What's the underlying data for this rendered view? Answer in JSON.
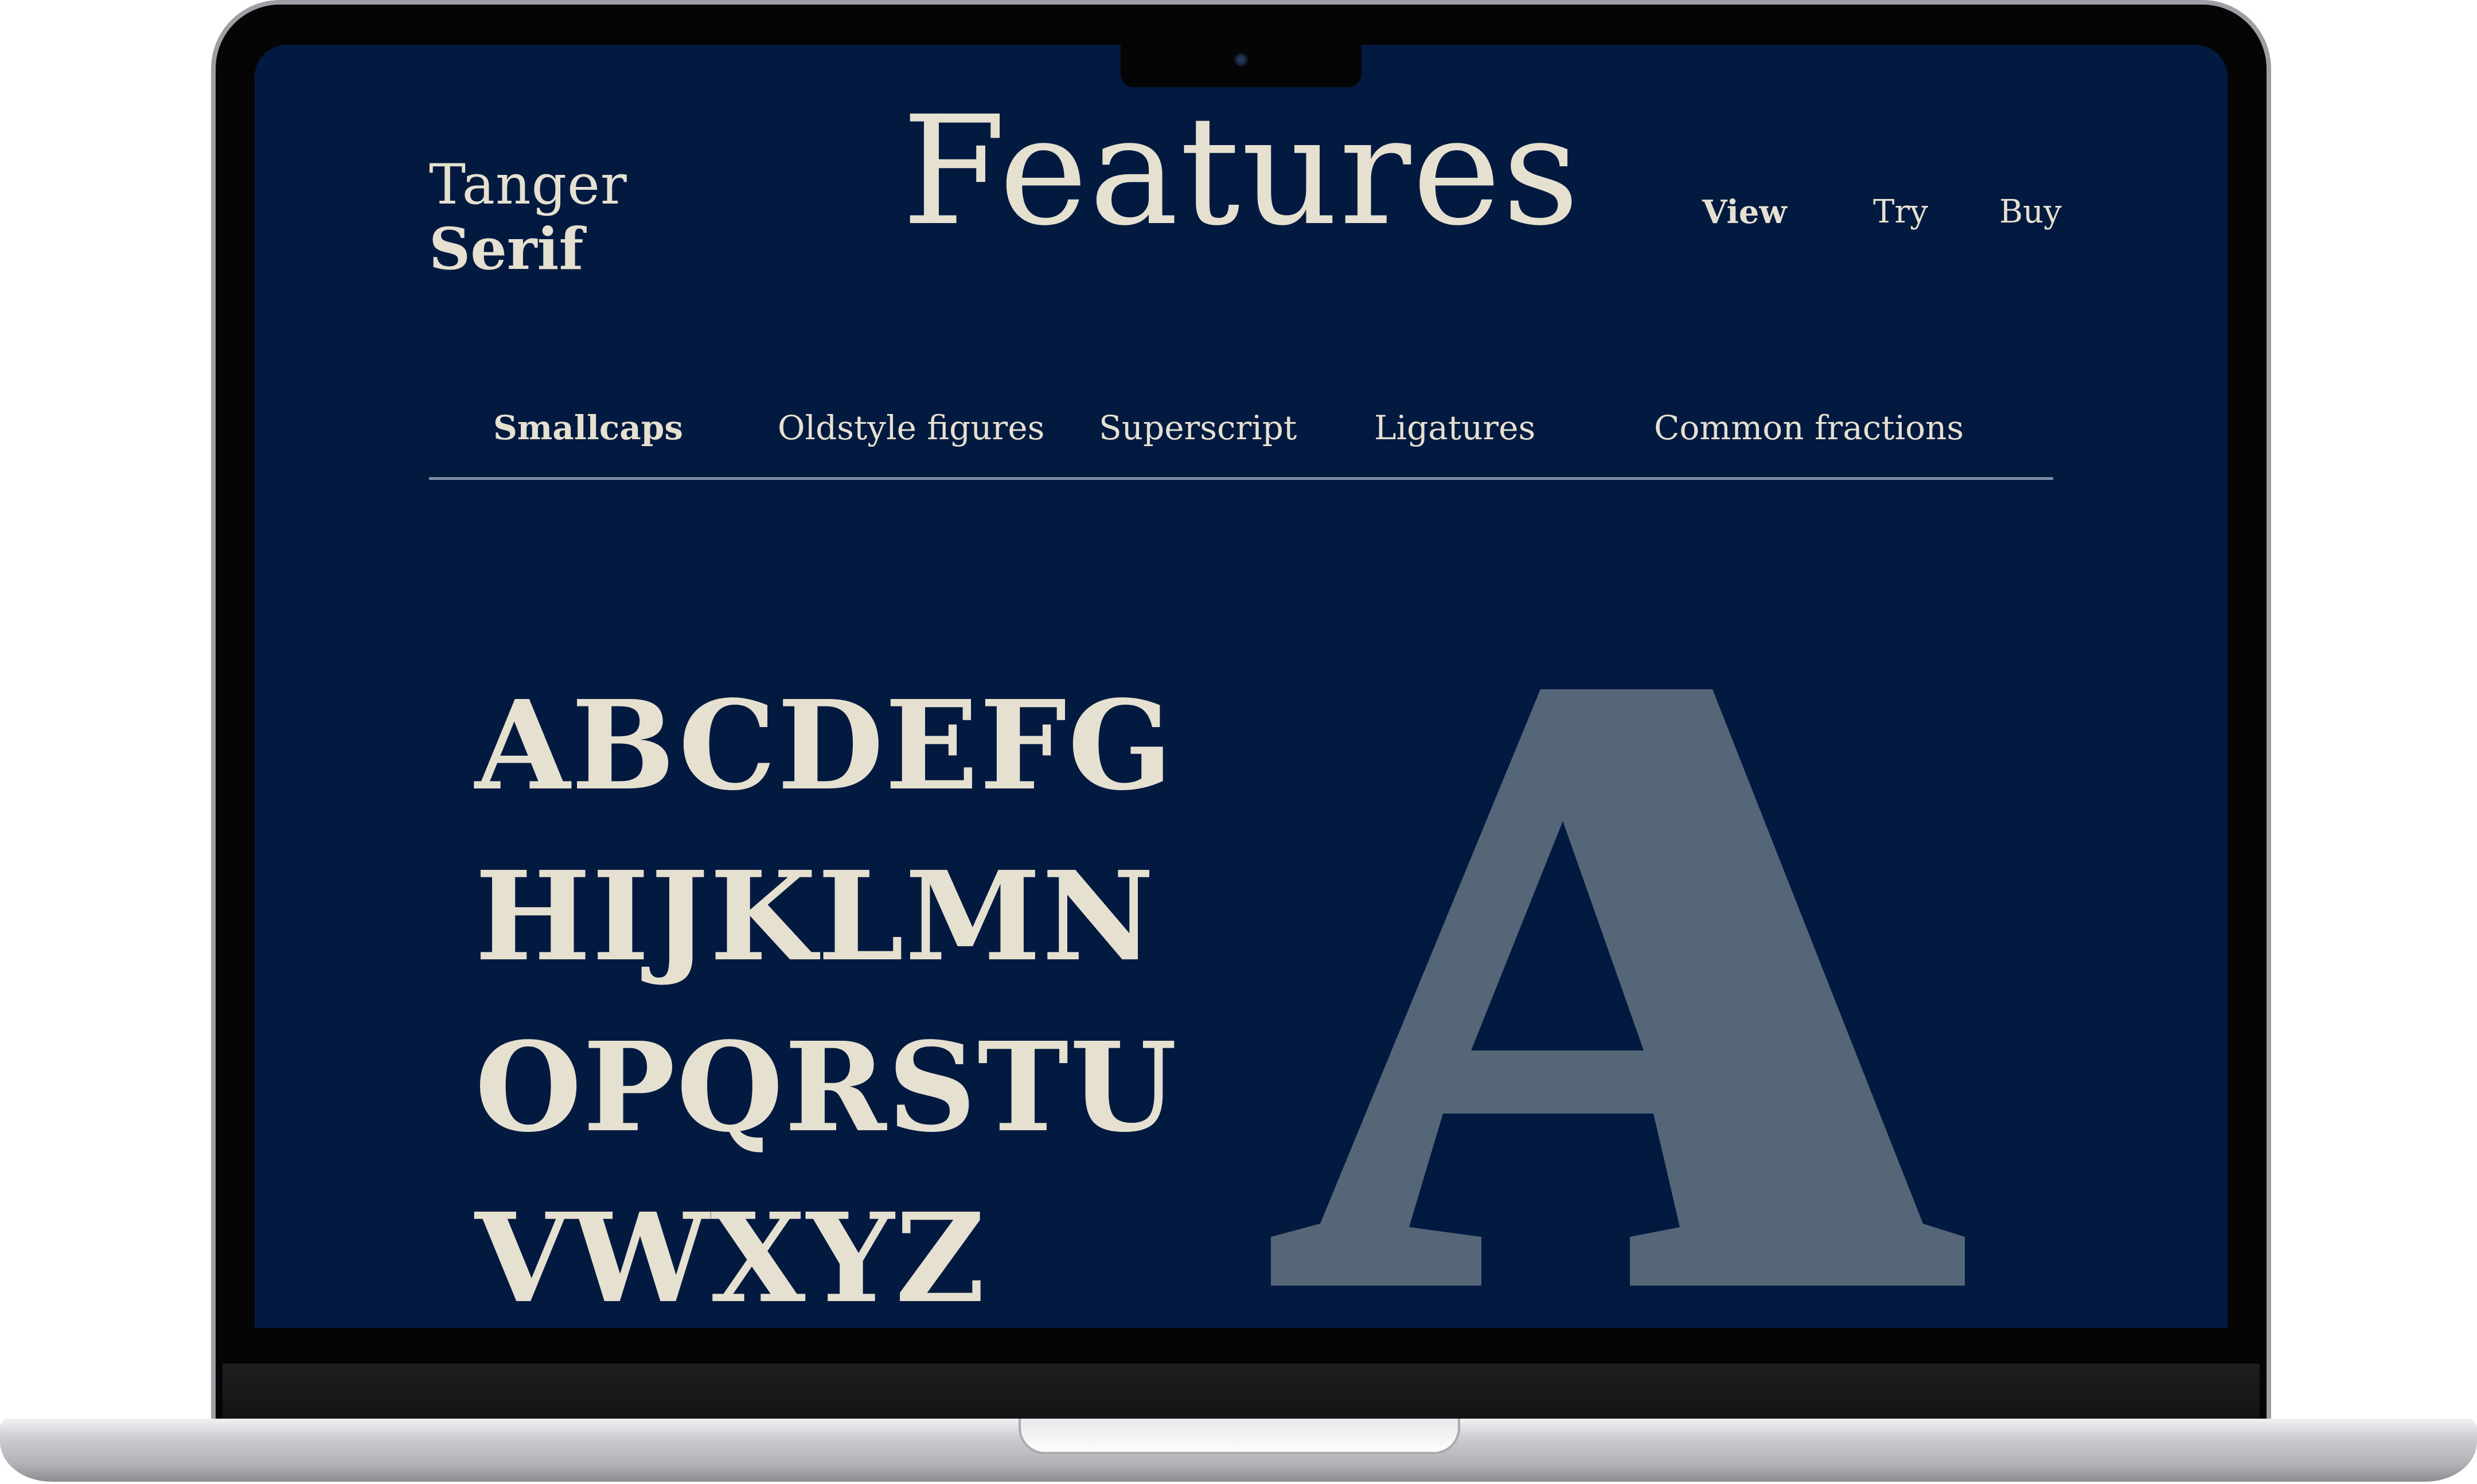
{
  "site": {
    "logo_line1": "Tanger",
    "logo_line2": "Serif",
    "page_title": "Features"
  },
  "nav": {
    "items": [
      "View",
      "Try",
      "Buy"
    ],
    "active": "View"
  },
  "tabs": {
    "items": [
      "Smallcaps",
      "Oldstyle figures",
      "Superscript",
      "Ligatures",
      "Common fractions"
    ],
    "active": "Smallcaps"
  },
  "specimen": {
    "rows": [
      "ABCDEFG",
      "HIJKLMN",
      "OPQRSTU",
      "VWXYZ"
    ],
    "large_glyph": "A"
  },
  "colors": {
    "background": "#031a40",
    "text": "#e5e0d0",
    "glyph": "#566679",
    "tab_underline": "#7c8ca3"
  }
}
